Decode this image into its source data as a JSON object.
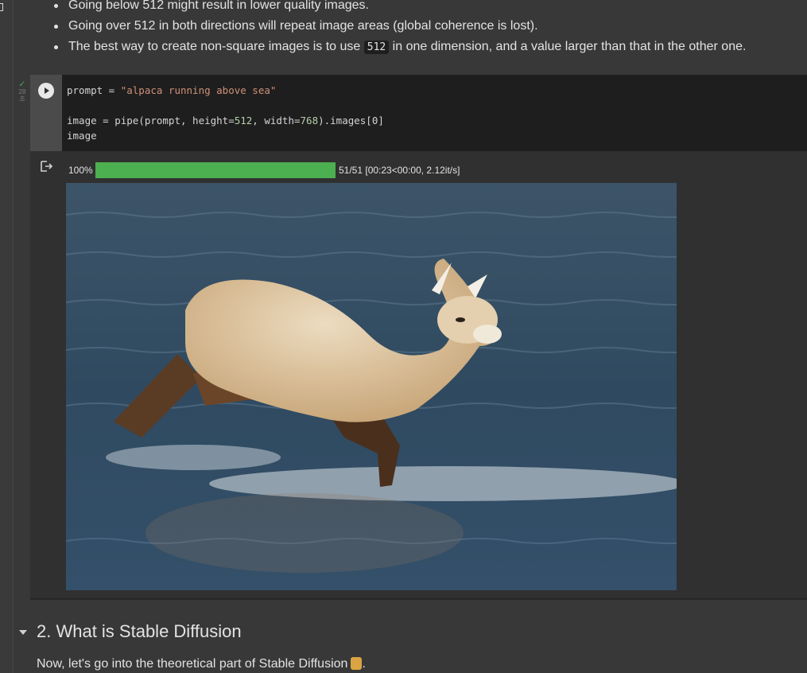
{
  "notes": {
    "bullets": [
      {
        "text": "Going below 512 might result in lower quality images."
      },
      {
        "text": "Going over 512 in both directions will repeat image areas (global coherence is lost)."
      },
      {
        "before": "The best way to create non-square images is to use ",
        "code": "512",
        "after": " in one dimension, and a value larger than that in the other one."
      }
    ]
  },
  "cell": {
    "exec_count": "28",
    "exec_unit": "초",
    "code_lines": {
      "l1_a": "prompt = ",
      "l1_str": "\"alpaca running above sea\"",
      "l3_a": "image = pipe(prompt, height=",
      "l3_n1": "512",
      "l3_b": ", width=",
      "l3_n2": "768",
      "l3_c": ").images[0]",
      "l4": "image"
    }
  },
  "output": {
    "progress_percent_label": "100%",
    "progress_fraction": 1.0,
    "progress_info": "51/51 [00:23<00:00, 2.12it/s]"
  },
  "section": {
    "heading": "2. What is Stable Diffusion",
    "paragraph": "Now, let's go into the theoretical part of Stable Diffusion",
    "paragraph_end": "."
  },
  "colors": {
    "background": "#383838",
    "code_bg": "#1e1e1e",
    "progress_fill": "#4caf50",
    "string": "#ce9178"
  }
}
